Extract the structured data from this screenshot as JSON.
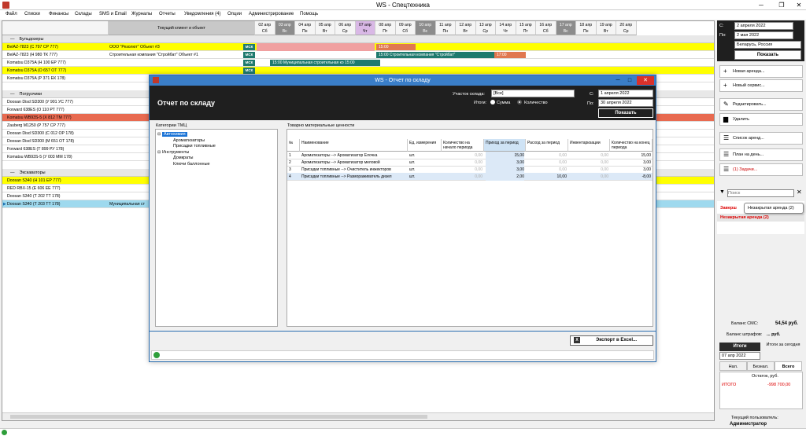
{
  "window": {
    "title": "WS - Спецтехника"
  },
  "menu": [
    "Файл",
    "Списки",
    "Финансы",
    "Склады",
    "SMS и Email",
    "Журналы",
    "Отчеты",
    "Уведомления (4)",
    "Опции",
    "Администрирование",
    "Помощь"
  ],
  "grid": {
    "current_header": "Текущий клиент и объект",
    "days": [
      {
        "d": "02 апр",
        "w": "Сб",
        "style": "norm"
      },
      {
        "d": "03 апр",
        "w": "Вс",
        "style": "dark"
      },
      {
        "d": "04 апр",
        "w": "Пн",
        "style": "norm"
      },
      {
        "d": "05 апр",
        "w": "Вт",
        "style": "norm"
      },
      {
        "d": "06 апр",
        "w": "Ср",
        "style": "norm"
      },
      {
        "d": "07 апр",
        "w": "Чт",
        "style": "pink"
      },
      {
        "d": "08 апр",
        "w": "Пт",
        "style": "norm"
      },
      {
        "d": "09 апр",
        "w": "Сб",
        "style": "norm"
      },
      {
        "d": "10 апр",
        "w": "Вс",
        "style": "dark"
      },
      {
        "d": "11 апр",
        "w": "Пн",
        "style": "norm"
      },
      {
        "d": "12 апр",
        "w": "Вт",
        "style": "norm"
      },
      {
        "d": "13 апр",
        "w": "Ср",
        "style": "norm"
      },
      {
        "d": "14 апр",
        "w": "Чт",
        "style": "norm"
      },
      {
        "d": "15 апр",
        "w": "Пт",
        "style": "norm"
      },
      {
        "d": "16 апр",
        "w": "Сб",
        "style": "norm"
      },
      {
        "d": "17 апр",
        "w": "Вс",
        "style": "dark"
      },
      {
        "d": "18 апр",
        "w": "Пн",
        "style": "norm"
      },
      {
        "d": "19 апр",
        "w": "Вт",
        "style": "norm"
      },
      {
        "d": "20 апр",
        "w": "Ср",
        "style": "norm"
      }
    ],
    "groups": {
      "g1": "Бульдозеры",
      "g2": "Погрузчики",
      "g3": "Экскаваторы"
    },
    "rows": [
      {
        "name": "BelAZ-7823 (С 797 СР 777)",
        "client": "ООО \"Резолют\"   Объект #3",
        "msk": "МСК",
        "bg": "#ffff00"
      },
      {
        "name": "BelAZ-7823 (Н 980 ТК 777)",
        "client": "Строительная компания \"Стройбат\"   Объект #1",
        "msk": "МСК",
        "bg": "#ffffff"
      },
      {
        "name": "Komatsu D375A (Н 100 ЕР 777)",
        "client": "",
        "msk": "МСК",
        "bg": "#ffffff"
      },
      {
        "name": "Komatsu D375A (О 657 ОТ 777)",
        "client": "",
        "msk": "МСК",
        "bg": "#ffff00"
      },
      {
        "name": "Komatsu D375A (Р 371 ЕК 178)",
        "client": "",
        "msk": "",
        "bg": "#ffffff"
      },
      {
        "name": "Doosan Disd SD300 (У 901 УС 777)",
        "client": "",
        "msk": "",
        "bg": "#ffffff"
      },
      {
        "name": "Forward 638ES (О 110 РТ 777)",
        "client": "",
        "msk": "",
        "bg": "#ffffff"
      },
      {
        "name": "Komatsu WB93S-5 (Х 812 ТМ 777)",
        "client": "",
        "msk": "",
        "bg": "#e86a50"
      },
      {
        "name": "Zauberg M1250 (Р 757 СР 777)",
        "client": "",
        "msk": "",
        "bg": "#ffffff"
      },
      {
        "name": "Doosan Disd SD300 (С 012 ОР 178)",
        "client": "",
        "msk": "",
        "bg": "#ffffff"
      },
      {
        "name": "Doosan Disd SD300 (М 651 ОТ 178)",
        "client": "",
        "msk": "",
        "bg": "#ffffff"
      },
      {
        "name": "Forward 638ES (Т 899 РУ 178)",
        "client": "",
        "msk": "",
        "bg": "#ffffff"
      },
      {
        "name": "Komatsu WB93S-5 (У 003 ММ 178)",
        "client": "",
        "msk": "",
        "bg": "#ffffff"
      },
      {
        "name": "Doosan S340 (Н 101 ЕР 777)",
        "client": "",
        "msk": "",
        "bg": "#ffff00"
      },
      {
        "name": "RED RBX-15 (Е 606 ЕЕ 777)",
        "client": "",
        "msk": "",
        "bg": "#ffffff"
      },
      {
        "name": "Doosan S340 (Т 202 ТТ 178)",
        "client": "",
        "msk": "",
        "bg": "#ffffff"
      },
      {
        "name": "Doosan S340 (Т 203 ТТ 178)",
        "client": "Муниципальная ст",
        "msk": "",
        "bg": "#9ed9ee"
      }
    ],
    "bars": {
      "b1": "15:00",
      "b2": "15:00 Строительная компания \"Стройбат\"",
      "b3": "17:00",
      "b4": "15:00 Муниципальная строительная ко  15:00"
    }
  },
  "right": {
    "from_label": "С:",
    "from_date": "2  апреля  2022",
    "to_label": "По:",
    "to_date": "2    мая    2022",
    "region": "Беларусь, Россия",
    "show": "Показать",
    "buttons": {
      "new_rent": "Новая аренда...",
      "new_service": "Новый сервис...",
      "edit": "Редактировать...",
      "delete": "Удалить",
      "rent_list": "Список аренд...",
      "day_plan": "План на день...",
      "tasks": "(1) Задачи..."
    },
    "search_placeholder": "Поиск",
    "closed": "Заверш",
    "tooltip": "Незакрытая аренда (2)",
    "unclosed": "Незакрытая аренда (2)",
    "balance_sms_label": "Баланс СМС:",
    "balance_sms": "54,54 руб.",
    "balance_fines_label": "Баланс штрафов:",
    "balance_fines": "... руб.",
    "totals": "Итоги",
    "totals_today": "Итоги за сегодня",
    "totals_date": "07 апр  2022",
    "seg": [
      "Нал.",
      "Безнал.",
      "Всего"
    ],
    "rest_label": "Остаток, руб.",
    "total_label": "ИТОГО",
    "total_value": "-998 700,00",
    "user_label": "Текущий пользователь:",
    "user": "Администратор"
  },
  "dialog": {
    "title": "WS - Отчет по складу",
    "heading": "Отчет по складу",
    "site_label": "Участок склада:",
    "site_value": "[Все]",
    "totals_label": "Итоги:",
    "opt_sum": "Сумма",
    "opt_qty": "Количество",
    "from_label": "С:",
    "from_date": "1    апреля   2022",
    "to_label": "По:",
    "to_date": "30  апреля   2022",
    "show": "Показать",
    "cat_header": "Категории ТМЦ",
    "tree": [
      {
        "t": "Автохимия",
        "lvl": 0,
        "sel": true
      },
      {
        "t": "Ароматизаторы",
        "lvl": 1,
        "sel": false
      },
      {
        "t": "Присадки топливные",
        "lvl": 1,
        "sel": false
      },
      {
        "t": "Инструменты",
        "lvl": 0,
        "sel": false
      },
      {
        "t": "Домкраты",
        "lvl": 1,
        "sel": false
      },
      {
        "t": "Ключи баллонные",
        "lvl": 1,
        "sel": false
      }
    ],
    "table_header": "Товарно материальные ценности",
    "cols": [
      "№",
      "Наименование",
      "Ед. измерения",
      "Количество на начало периода",
      "Приход за период",
      "Расход за период",
      "Инвентаризации",
      "Количество на конец периода"
    ],
    "rows": [
      {
        "n": "1",
        "name": "Ароматизаторы --> Ароматизатор Елочка",
        "unit": "шт.",
        "start": "0,00",
        "in": "15,00",
        "out": "0,00",
        "inv": "0,00",
        "end": "15,00"
      },
      {
        "n": "2",
        "name": "Ароматизаторы --> Ароматизатор меловой",
        "unit": "шт.",
        "start": "0,00",
        "in": "3,00",
        "out": "0,00",
        "inv": "0,00",
        "end": "3,00"
      },
      {
        "n": "3",
        "name": "Присадки топливные --> Очиститель инжекторов",
        "unit": "шт.",
        "start": "0,00",
        "in": "3,00",
        "out": "0,00",
        "inv": "0,00",
        "end": "3,00"
      },
      {
        "n": "4",
        "name": "Присадки топливные --> Размораживатель дизел",
        "unit": "шт.",
        "start": "0,00",
        "in": "2,00",
        "out": "10,00",
        "inv": "0,00",
        "end": "-8,00"
      }
    ],
    "export": "Экспорт в Excel..."
  }
}
